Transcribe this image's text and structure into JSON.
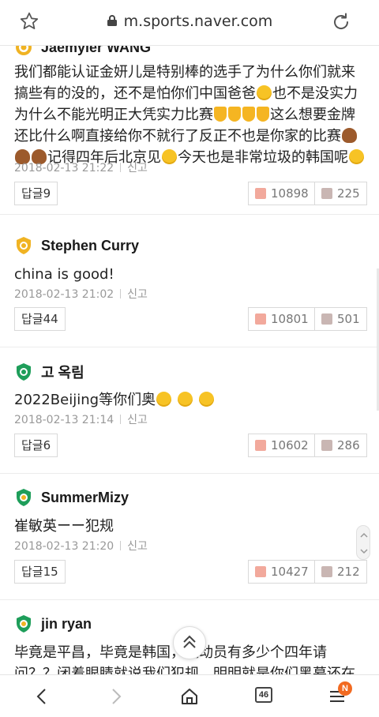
{
  "browser": {
    "url": "m.sports.naver.com"
  },
  "comments": [
    {
      "username": "Jaemyler WANG",
      "text_parts": [
        "我们都能认证金妍儿是特别棒的选手了为什么你们就来搞些有的没的，还不是怕你们中国爸爸",
        "也不是没实力为什么不能光明正大凭实力比赛",
        "这么想要金牌还比什么啊直接给你不就行了反正不也是你家的比赛",
        "记得四年后北京见",
        "今天也是非常垃圾的韩国呢"
      ],
      "timestamp": "2018-02-13 21:22",
      "report": "신고",
      "reply": "답글9",
      "likes": "10898",
      "dislikes": "225"
    },
    {
      "username": "Stephen Curry",
      "text": "china is good!",
      "timestamp": "2018-02-13 21:02",
      "report": "신고",
      "reply": "답글44",
      "likes": "10801",
      "dislikes": "501"
    },
    {
      "username": "고 옥림",
      "text": "2022Beijing等你们奥",
      "timestamp": "2018-02-13 21:14",
      "report": "신고",
      "reply": "답글6",
      "likes": "10602",
      "dislikes": "286"
    },
    {
      "username": "SummerMizy",
      "text": "崔敏英ーー犯规",
      "timestamp": "2018-02-13 21:20",
      "report": "신고",
      "reply": "답글15",
      "likes": "10427",
      "dislikes": "212"
    },
    {
      "username": "jin ryan",
      "text": "毕竟是平昌，毕竟是韩国，运动员有多少个四年请问？？闭着眼睛就说我们犯规，明明就是你们黑幕还在那装白"
    }
  ],
  "bottom_nav": {
    "tab_count": "46",
    "notification_badge": "N"
  },
  "colors": {
    "accent_badge_gold": "#f0b323",
    "badge_green": "#1e9e5a",
    "notification": "#f26a21"
  }
}
